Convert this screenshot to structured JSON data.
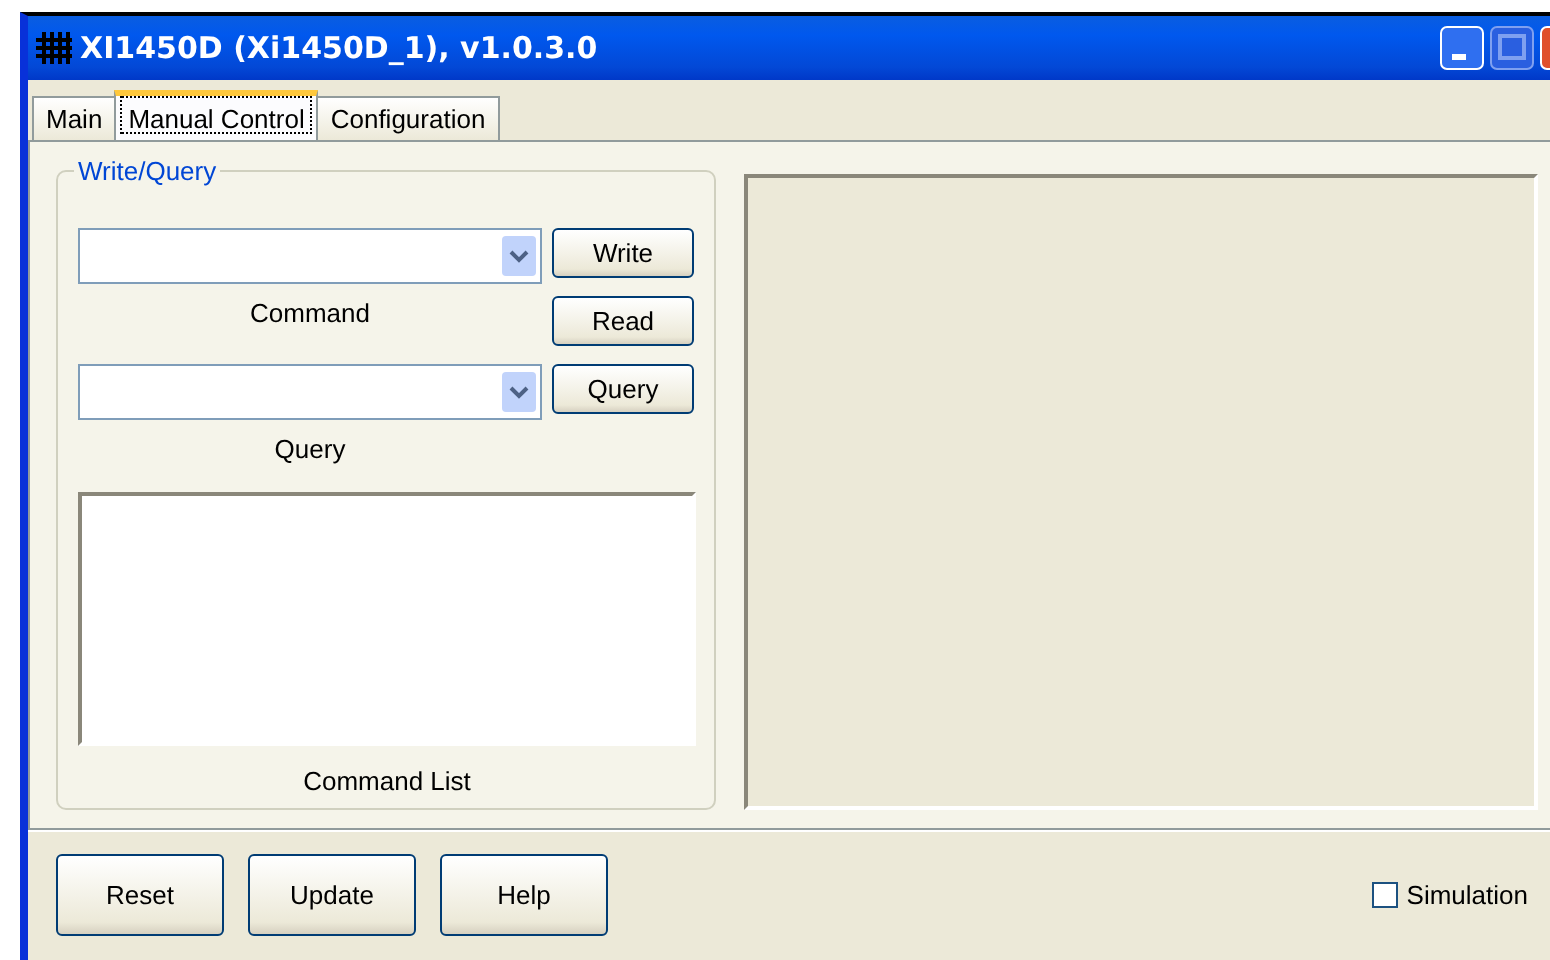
{
  "window": {
    "title": "XI1450D (Xi1450D_1), v1.0.3.0"
  },
  "tabs": [
    {
      "label": "Main",
      "selected": false
    },
    {
      "label": "Manual Control",
      "selected": true
    },
    {
      "label": "Configuration",
      "selected": false
    }
  ],
  "group": {
    "title": "Write/Query",
    "command_field": {
      "label": "Command"
    },
    "query_field": {
      "label": "Query"
    },
    "buttons": [
      "Write",
      "Read",
      "Query"
    ],
    "list": {
      "label": "Command List"
    }
  },
  "footer": {
    "buttons": [
      "Reset",
      "Update",
      "Help"
    ],
    "simulation": {
      "label": "Simulation",
      "checked": false
    }
  }
}
